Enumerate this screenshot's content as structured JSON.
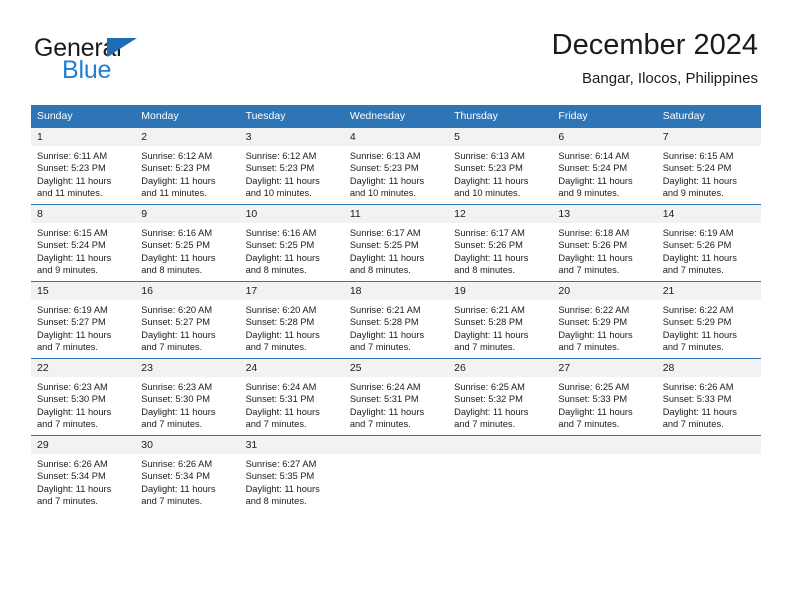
{
  "brand": {
    "word1": "General",
    "word2": "Blue",
    "triangle_color": "#1f6cb4",
    "blue_color": "#1f7fd4"
  },
  "header": {
    "title": "December 2024",
    "subtitle": "Bangar, Ilocos, Philippines"
  },
  "theme": {
    "header_bg": "#2e75b6",
    "header_text": "#ffffff",
    "daynum_bg": "#f2f2f2",
    "text": "#1c1c1c"
  },
  "weekdays": [
    "Sunday",
    "Monday",
    "Tuesday",
    "Wednesday",
    "Thursday",
    "Friday",
    "Saturday"
  ],
  "weeks": [
    [
      {
        "day": "1",
        "sunrise": "Sunrise: 6:11 AM",
        "sunset": "Sunset: 5:23 PM",
        "daylight1": "Daylight: 11 hours",
        "daylight2": "and 11 minutes."
      },
      {
        "day": "2",
        "sunrise": "Sunrise: 6:12 AM",
        "sunset": "Sunset: 5:23 PM",
        "daylight1": "Daylight: 11 hours",
        "daylight2": "and 11 minutes."
      },
      {
        "day": "3",
        "sunrise": "Sunrise: 6:12 AM",
        "sunset": "Sunset: 5:23 PM",
        "daylight1": "Daylight: 11 hours",
        "daylight2": "and 10 minutes."
      },
      {
        "day": "4",
        "sunrise": "Sunrise: 6:13 AM",
        "sunset": "Sunset: 5:23 PM",
        "daylight1": "Daylight: 11 hours",
        "daylight2": "and 10 minutes."
      },
      {
        "day": "5",
        "sunrise": "Sunrise: 6:13 AM",
        "sunset": "Sunset: 5:23 PM",
        "daylight1": "Daylight: 11 hours",
        "daylight2": "and 10 minutes."
      },
      {
        "day": "6",
        "sunrise": "Sunrise: 6:14 AM",
        "sunset": "Sunset: 5:24 PM",
        "daylight1": "Daylight: 11 hours",
        "daylight2": "and 9 minutes."
      },
      {
        "day": "7",
        "sunrise": "Sunrise: 6:15 AM",
        "sunset": "Sunset: 5:24 PM",
        "daylight1": "Daylight: 11 hours",
        "daylight2": "and 9 minutes."
      }
    ],
    [
      {
        "day": "8",
        "sunrise": "Sunrise: 6:15 AM",
        "sunset": "Sunset: 5:24 PM",
        "daylight1": "Daylight: 11 hours",
        "daylight2": "and 9 minutes."
      },
      {
        "day": "9",
        "sunrise": "Sunrise: 6:16 AM",
        "sunset": "Sunset: 5:25 PM",
        "daylight1": "Daylight: 11 hours",
        "daylight2": "and 8 minutes."
      },
      {
        "day": "10",
        "sunrise": "Sunrise: 6:16 AM",
        "sunset": "Sunset: 5:25 PM",
        "daylight1": "Daylight: 11 hours",
        "daylight2": "and 8 minutes."
      },
      {
        "day": "11",
        "sunrise": "Sunrise: 6:17 AM",
        "sunset": "Sunset: 5:25 PM",
        "daylight1": "Daylight: 11 hours",
        "daylight2": "and 8 minutes."
      },
      {
        "day": "12",
        "sunrise": "Sunrise: 6:17 AM",
        "sunset": "Sunset: 5:26 PM",
        "daylight1": "Daylight: 11 hours",
        "daylight2": "and 8 minutes."
      },
      {
        "day": "13",
        "sunrise": "Sunrise: 6:18 AM",
        "sunset": "Sunset: 5:26 PM",
        "daylight1": "Daylight: 11 hours",
        "daylight2": "and 7 minutes."
      },
      {
        "day": "14",
        "sunrise": "Sunrise: 6:19 AM",
        "sunset": "Sunset: 5:26 PM",
        "daylight1": "Daylight: 11 hours",
        "daylight2": "and 7 minutes."
      }
    ],
    [
      {
        "day": "15",
        "sunrise": "Sunrise: 6:19 AM",
        "sunset": "Sunset: 5:27 PM",
        "daylight1": "Daylight: 11 hours",
        "daylight2": "and 7 minutes."
      },
      {
        "day": "16",
        "sunrise": "Sunrise: 6:20 AM",
        "sunset": "Sunset: 5:27 PM",
        "daylight1": "Daylight: 11 hours",
        "daylight2": "and 7 minutes."
      },
      {
        "day": "17",
        "sunrise": "Sunrise: 6:20 AM",
        "sunset": "Sunset: 5:28 PM",
        "daylight1": "Daylight: 11 hours",
        "daylight2": "and 7 minutes."
      },
      {
        "day": "18",
        "sunrise": "Sunrise: 6:21 AM",
        "sunset": "Sunset: 5:28 PM",
        "daylight1": "Daylight: 11 hours",
        "daylight2": "and 7 minutes."
      },
      {
        "day": "19",
        "sunrise": "Sunrise: 6:21 AM",
        "sunset": "Sunset: 5:28 PM",
        "daylight1": "Daylight: 11 hours",
        "daylight2": "and 7 minutes."
      },
      {
        "day": "20",
        "sunrise": "Sunrise: 6:22 AM",
        "sunset": "Sunset: 5:29 PM",
        "daylight1": "Daylight: 11 hours",
        "daylight2": "and 7 minutes."
      },
      {
        "day": "21",
        "sunrise": "Sunrise: 6:22 AM",
        "sunset": "Sunset: 5:29 PM",
        "daylight1": "Daylight: 11 hours",
        "daylight2": "and 7 minutes."
      }
    ],
    [
      {
        "day": "22",
        "sunrise": "Sunrise: 6:23 AM",
        "sunset": "Sunset: 5:30 PM",
        "daylight1": "Daylight: 11 hours",
        "daylight2": "and 7 minutes."
      },
      {
        "day": "23",
        "sunrise": "Sunrise: 6:23 AM",
        "sunset": "Sunset: 5:30 PM",
        "daylight1": "Daylight: 11 hours",
        "daylight2": "and 7 minutes."
      },
      {
        "day": "24",
        "sunrise": "Sunrise: 6:24 AM",
        "sunset": "Sunset: 5:31 PM",
        "daylight1": "Daylight: 11 hours",
        "daylight2": "and 7 minutes."
      },
      {
        "day": "25",
        "sunrise": "Sunrise: 6:24 AM",
        "sunset": "Sunset: 5:31 PM",
        "daylight1": "Daylight: 11 hours",
        "daylight2": "and 7 minutes."
      },
      {
        "day": "26",
        "sunrise": "Sunrise: 6:25 AM",
        "sunset": "Sunset: 5:32 PM",
        "daylight1": "Daylight: 11 hours",
        "daylight2": "and 7 minutes."
      },
      {
        "day": "27",
        "sunrise": "Sunrise: 6:25 AM",
        "sunset": "Sunset: 5:33 PM",
        "daylight1": "Daylight: 11 hours",
        "daylight2": "and 7 minutes."
      },
      {
        "day": "28",
        "sunrise": "Sunrise: 6:26 AM",
        "sunset": "Sunset: 5:33 PM",
        "daylight1": "Daylight: 11 hours",
        "daylight2": "and 7 minutes."
      }
    ],
    [
      {
        "day": "29",
        "sunrise": "Sunrise: 6:26 AM",
        "sunset": "Sunset: 5:34 PM",
        "daylight1": "Daylight: 11 hours",
        "daylight2": "and 7 minutes."
      },
      {
        "day": "30",
        "sunrise": "Sunrise: 6:26 AM",
        "sunset": "Sunset: 5:34 PM",
        "daylight1": "Daylight: 11 hours",
        "daylight2": "and 7 minutes."
      },
      {
        "day": "31",
        "sunrise": "Sunrise: 6:27 AM",
        "sunset": "Sunset: 5:35 PM",
        "daylight1": "Daylight: 11 hours",
        "daylight2": "and 8 minutes."
      },
      {
        "day": "",
        "sunrise": "",
        "sunset": "",
        "daylight1": "",
        "daylight2": ""
      },
      {
        "day": "",
        "sunrise": "",
        "sunset": "",
        "daylight1": "",
        "daylight2": ""
      },
      {
        "day": "",
        "sunrise": "",
        "sunset": "",
        "daylight1": "",
        "daylight2": ""
      },
      {
        "day": "",
        "sunrise": "",
        "sunset": "",
        "daylight1": "",
        "daylight2": ""
      }
    ]
  ]
}
